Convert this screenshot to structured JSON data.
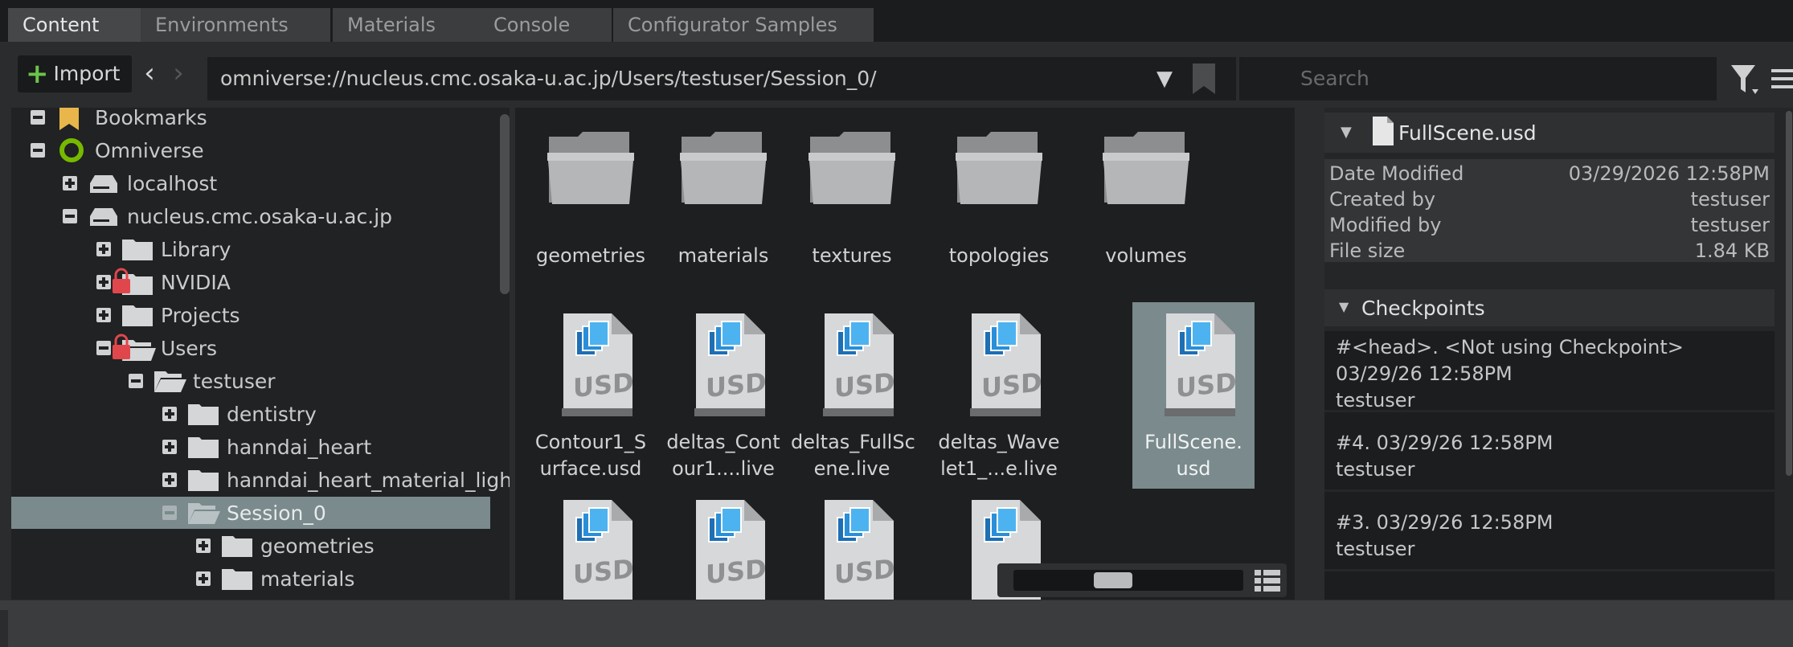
{
  "tabs": [
    {
      "label": "Content"
    },
    {
      "label": "Environments"
    },
    {
      "label": "Materials"
    },
    {
      "label": "Console"
    },
    {
      "label": "Configurator Samples"
    }
  ],
  "toolbar": {
    "import_label": "Import",
    "path": "omniverse://nucleus.cmc.osaka-u.ac.jp/Users/testuser/Session_0/",
    "search_placeholder": "Search"
  },
  "tree": {
    "items": [
      {
        "label": "Bookmarks",
        "icon": "bookmark-icon",
        "state": "expanded"
      },
      {
        "label": "Omniverse",
        "icon": "omniverse-logo-icon",
        "state": "expanded"
      },
      {
        "label": "localhost",
        "icon": "server-icon",
        "state": "collapsed"
      },
      {
        "label": "nucleus.cmc.osaka-u.ac.jp",
        "icon": "server-icon",
        "state": "expanded"
      },
      {
        "label": "Library",
        "icon": "folder-icon",
        "state": "collapsed"
      },
      {
        "label": "NVIDIA",
        "icon": "locked-folder-icon",
        "state": "collapsed"
      },
      {
        "label": "Projects",
        "icon": "folder-icon",
        "state": "collapsed"
      },
      {
        "label": "Users",
        "icon": "locked-folder-icon",
        "state": "expanded"
      },
      {
        "label": "testuser",
        "icon": "open-folder-icon",
        "state": "expanded"
      },
      {
        "label": "dentistry",
        "icon": "folder-icon",
        "state": "collapsed"
      },
      {
        "label": "hanndai_heart",
        "icon": "folder-icon",
        "state": "collapsed"
      },
      {
        "label": "hanndai_heart_material_ligh",
        "icon": "folder-icon",
        "state": "collapsed"
      },
      {
        "label": "Session_0",
        "icon": "open-folder-icon",
        "state": "expanded",
        "selected": true
      },
      {
        "label": "geometries",
        "icon": "folder-icon",
        "state": "collapsed"
      },
      {
        "label": "materials",
        "icon": "folder-icon",
        "state": "collapsed"
      }
    ]
  },
  "grid": {
    "folders": [
      "geometries",
      "materials",
      "textures",
      "topologies",
      "volumes"
    ],
    "files": [
      {
        "line1": "Contour1_S",
        "line2": "urface.usd"
      },
      {
        "line1": "deltas_Cont",
        "line2": "our1....live"
      },
      {
        "line1": "deltas_FullSc",
        "line2": "ene.live"
      },
      {
        "line1": "deltas_Wave",
        "line2": "let1_...e.live"
      },
      {
        "line1": "FullScene.",
        "line2": "usd",
        "selected": true
      }
    ],
    "usd_badge": "USD"
  },
  "details": {
    "file_name": "FullScene.usd",
    "meta": [
      {
        "key": "Date Modified",
        "value": "03/29/2026 12:58PM"
      },
      {
        "key": "Created by",
        "value": "testuser"
      },
      {
        "key": "Modified by",
        "value": "testuser"
      },
      {
        "key": "File size",
        "value": "1.84 KB"
      }
    ],
    "checkpoints_title": "Checkpoints",
    "checkpoints": [
      {
        "line1": "#<head>.   <Not using Checkpoint>",
        "line2": "03/29/26 12:58PM",
        "line3": "testuser"
      },
      {
        "line1": "#4.   03/29/26 12:58PM",
        "line2": "testuser"
      },
      {
        "line1": "#3.   03/29/26 12:58PM",
        "line2": "testuser"
      }
    ]
  },
  "colors": {
    "accent_green": "#6cc24a",
    "selection": "#7a8a8d",
    "bookmark_yellow": "#e8b64a",
    "lock_red": "#e0474c"
  }
}
